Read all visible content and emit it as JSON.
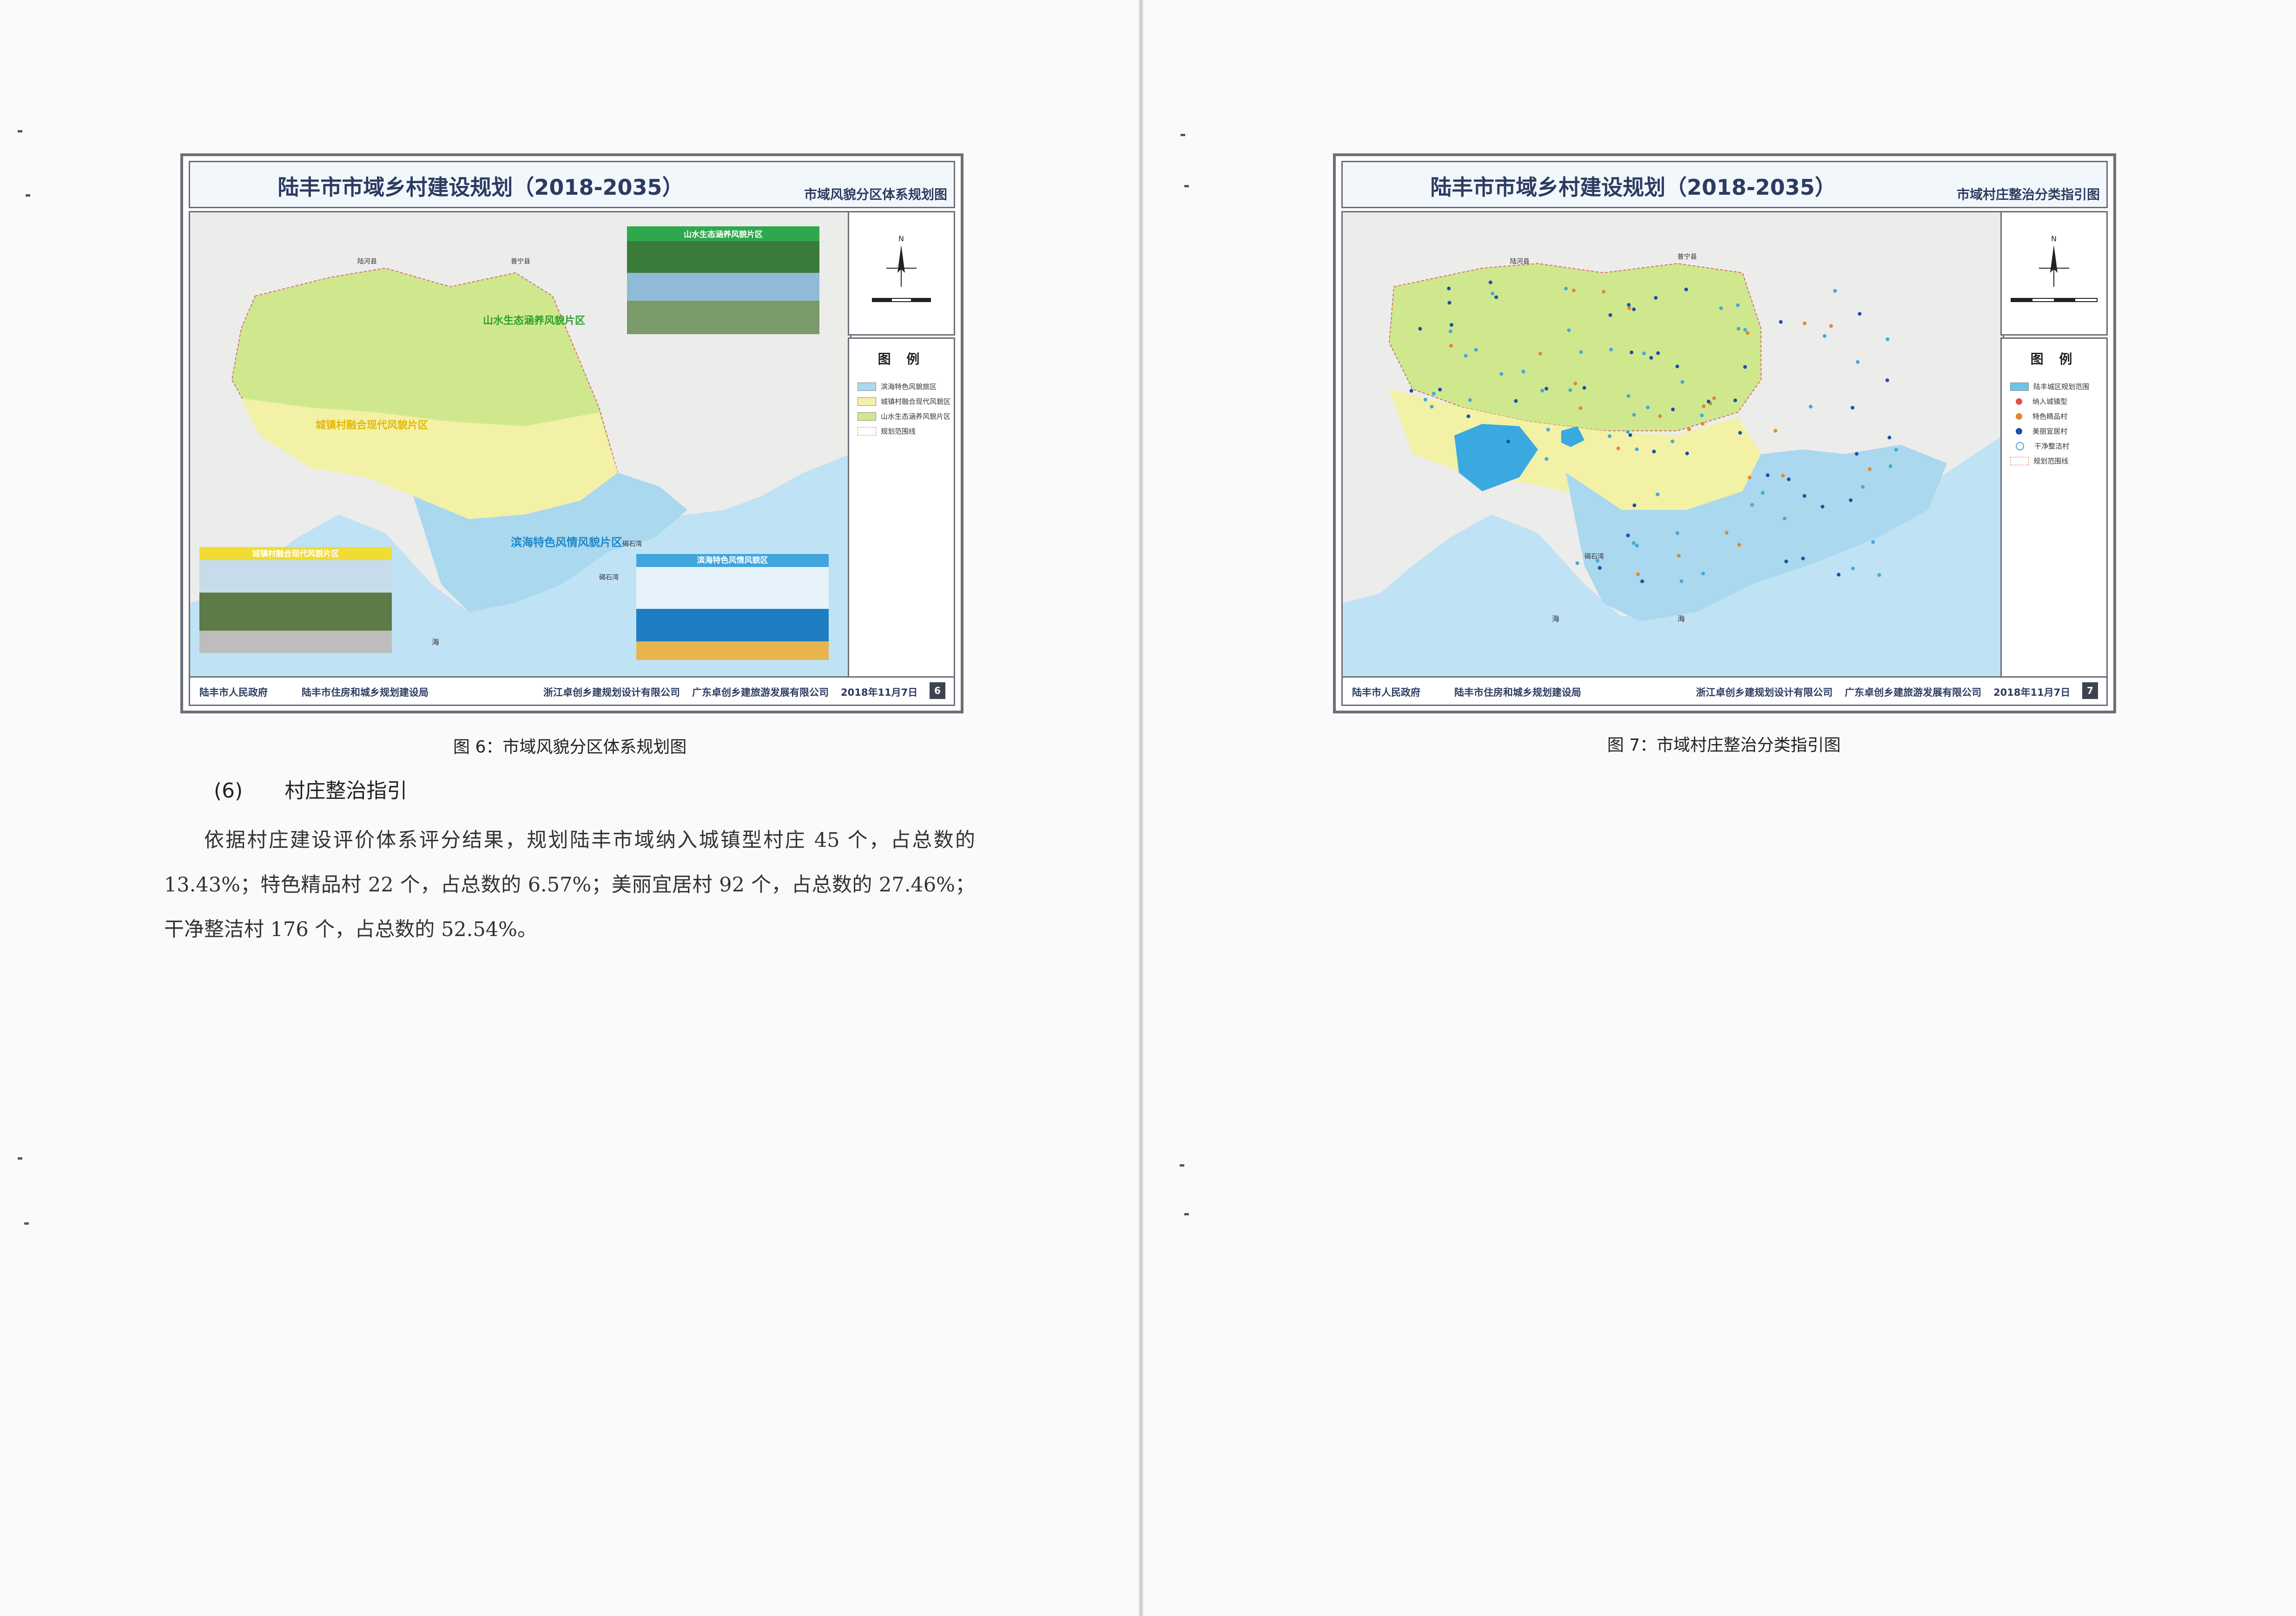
{
  "left_map": {
    "header_title": "陆丰市市域乡村建设规划（2018-2035）",
    "header_subtitle": "市域风貌分区体系规划图",
    "zones": {
      "mountain": "山水生态涵养风貌片区",
      "town_village": "城镇村融合现代风貌片区",
      "coastal": "滨海特色风情风貌片区"
    },
    "photo_captions": {
      "mountain": "山水生态涵养风貌片区",
      "town_village": "城镇村融合现代风貌片区",
      "coastal": "滨海特色风情风貌区"
    },
    "place_labels": {
      "north_county": "陆河县",
      "ne_county": "普宁县",
      "bay": "碣石湾",
      "bay2": "碣石湾",
      "sea": "海"
    },
    "legend": {
      "title": "图 例",
      "items": [
        "滨海特色风貌旅区",
        "城镇村融合现代风貌区",
        "山水生态涵养风貌片区",
        "规划范围线"
      ]
    },
    "footer": {
      "gov": "陆丰市人民政府",
      "bureau": "陆丰市住房和城乡规划建设局",
      "design1": "浙江卓创乡建规划设计有限公司",
      "design2": "广东卓创乡建旅游发展有限公司",
      "date": "2018年11月7日",
      "page": "6"
    },
    "caption": "图 6：市域风貌分区体系规划图"
  },
  "right_map": {
    "header_title": "陆丰市市域乡村建设规划（2018-2035）",
    "header_subtitle": "市域村庄整治分类指引图",
    "place_labels": {
      "north_county": "陆河县",
      "ne_county": "普宁县",
      "bay": "碣石湾",
      "sea1": "海",
      "sea2": "海"
    },
    "legend": {
      "title": "图 例",
      "items": [
        "陆丰城区规划范围",
        "纳入城镇型",
        "特色精品村",
        "美丽宜居村",
        "干净整洁村",
        "规划范围线"
      ]
    },
    "footer": {
      "gov": "陆丰市人民政府",
      "bureau": "陆丰市住房和城乡规划建设局",
      "design1": "浙江卓创乡建规划设计有限公司",
      "design2": "广东卓创乡建旅游发展有限公司",
      "date": "2018年11月7日",
      "page": "7"
    },
    "caption": "图 7：市域村庄整治分类指引图"
  },
  "section": {
    "number": "(6)",
    "title": "村庄整治指引",
    "paragraph": "依据村庄建设评价体系评分结果，规划陆丰市域纳入城镇型村庄 45 个，占总数的 13.43%；特色精品村 22 个，占总数的 6.57%；美丽宜居村 92 个，占总数的 27.46%；干净整洁村 176 个，占总数的 52.54%。"
  },
  "colors": {
    "coastal": "#a9d8ef",
    "town_village": "#f3f1a6",
    "mountain": "#cfe88e",
    "urban_core": "#3aa9e0",
    "sea": "#bfe2f4",
    "land": "#ececea",
    "frame": "#6c6e78",
    "dot_urban": "#d9534f",
    "dot_feature": "#e08a2c",
    "dot_beautiful": "#1f4fa8",
    "dot_clean": "#47a8d8"
  }
}
